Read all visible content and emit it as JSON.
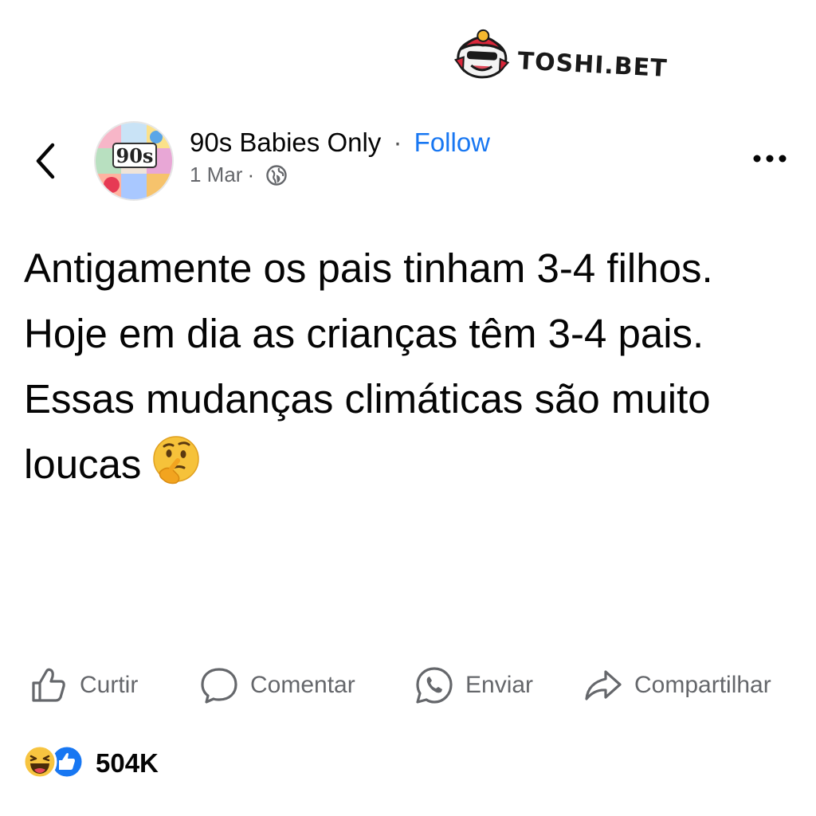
{
  "watermark": {
    "text": "TOSHI.BET"
  },
  "header": {
    "page_name": "90s Babies Only",
    "separator": "·",
    "follow_label": "Follow",
    "date": "1 Mar",
    "meta_separator": "·",
    "avatar_text": "90s"
  },
  "post": {
    "lines": [
      "Antigamente os pais tinham 3-4 filhos.",
      "Hoje em dia as crianças têm 3-4 pais.",
      "Essas mudanças climáticas são muito loucas"
    ]
  },
  "actions": {
    "like_label": "Curtir",
    "comment_label": "Comentar",
    "send_label": "Enviar",
    "share_label": "Compartilhar"
  },
  "reactions": {
    "count": "504K"
  }
}
